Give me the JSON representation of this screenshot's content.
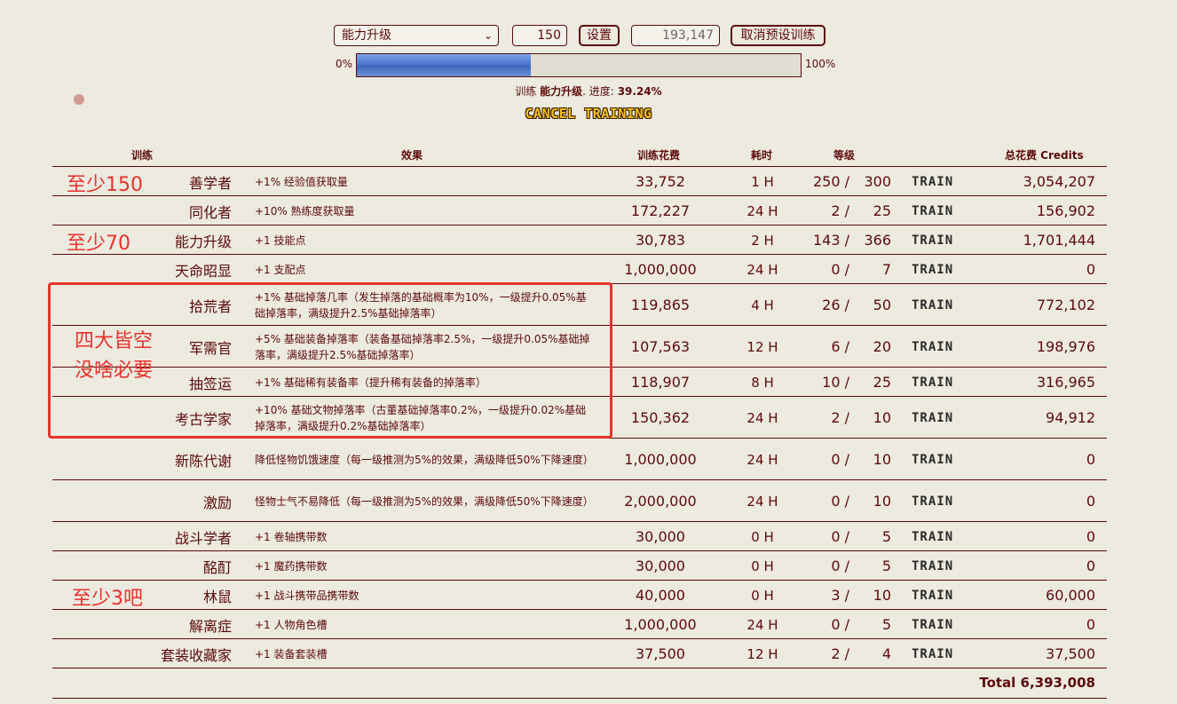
{
  "controls": {
    "select_value": "能力升级",
    "quantity_value": "150",
    "set_label": "设置",
    "credits_value": "193,147",
    "cancel_preset_label": "取消预设训练"
  },
  "progress": {
    "min_label": "0%",
    "max_label": "100%",
    "fraction": 0.3924,
    "status_prefix": "训练",
    "status_skill": "能力升级",
    "status_mid": ". 进度:",
    "status_pct": "39.24%",
    "cancel_label": "CANCEL TRAINING"
  },
  "table": {
    "headers": {
      "train": "训练",
      "effect": "效果",
      "cost": "训练花费",
      "time": "耗时",
      "level": "等级",
      "total": "总花费 Credits"
    },
    "rows": [
      {
        "name": "善学者",
        "effect": "+1% 经验值获取量",
        "cost": "33,752",
        "time": "1 H",
        "level": "250 /",
        "max": "300",
        "train": "TRAIN",
        "total": "3,054,207"
      },
      {
        "name": "同化者",
        "effect": "+10% 熟练度获取量",
        "cost": "172,227",
        "time": "24 H",
        "level": "2 /",
        "max": "25",
        "train": "TRAIN",
        "total": "156,902"
      },
      {
        "name": "能力升级",
        "effect": "+1 技能点",
        "cost": "30,783",
        "time": "2 H",
        "level": "143 /",
        "max": "366",
        "train": "TRAIN",
        "total": "1,701,444"
      },
      {
        "name": "天命昭显",
        "effect": "+1 支配点",
        "cost": "1,000,000",
        "time": "24 H",
        "level": "0 /",
        "max": "7",
        "train": "TRAIN",
        "total": "0"
      },
      {
        "name": "拾荒者",
        "effect": "+1% 基础掉落几率（发生掉落的基础概率为10%，一级提升0.05%基础掉落率，满级提升2.5%基础掉落率）",
        "cost": "119,865",
        "time": "4 H",
        "level": "26 /",
        "max": "50",
        "train": "TRAIN",
        "total": "772,102"
      },
      {
        "name": "军需官",
        "effect": "+5% 基础装备掉落率（装备基础掉落率2.5%，一级提升0.05%基础掉落率，满级提升2.5%基础掉落率）",
        "cost": "107,563",
        "time": "12 H",
        "level": "6 /",
        "max": "20",
        "train": "TRAIN",
        "total": "198,976"
      },
      {
        "name": "抽签运",
        "effect": "+1% 基础稀有装备率（提升稀有装备的掉落率）",
        "cost": "118,907",
        "time": "8 H",
        "level": "10 /",
        "max": "25",
        "train": "TRAIN",
        "total": "316,965"
      },
      {
        "name": "考古学家",
        "effect": "+10% 基础文物掉落率（古董基础掉落率0.2%，一级提升0.02%基础掉落率，满级提升0.2%基础掉落率）",
        "cost": "150,362",
        "time": "24 H",
        "level": "2 /",
        "max": "10",
        "train": "TRAIN",
        "total": "94,912"
      },
      {
        "name": "新陈代谢",
        "effect": "降低怪物饥饿速度（每一级推测为5%的效果，满级降低50%下降速度）",
        "cost": "1,000,000",
        "time": "24 H",
        "level": "0 /",
        "max": "10",
        "train": "TRAIN",
        "total": "0"
      },
      {
        "name": "激励",
        "effect": "怪物士气不易降低（每一级推测为5%的效果，满级降低50%下降速度）",
        "cost": "2,000,000",
        "time": "24 H",
        "level": "0 /",
        "max": "10",
        "train": "TRAIN",
        "total": "0"
      },
      {
        "name": "战斗学者",
        "effect": "+1 卷轴携带数",
        "cost": "30,000",
        "time": "0 H",
        "level": "0 /",
        "max": "5",
        "train": "TRAIN",
        "total": "0"
      },
      {
        "name": "酩酊",
        "effect": "+1 魔药携带数",
        "cost": "30,000",
        "time": "0 H",
        "level": "0 /",
        "max": "5",
        "train": "TRAIN",
        "total": "0"
      },
      {
        "name": "林鼠",
        "effect": "+1 战斗携带品携带数",
        "cost": "40,000",
        "time": "0 H",
        "level": "3 /",
        "max": "10",
        "train": "TRAIN",
        "total": "60,000"
      },
      {
        "name": "解离症",
        "effect": "+1 人物角色槽",
        "cost": "1,000,000",
        "time": "24 H",
        "level": "0 /",
        "max": "5",
        "train": "TRAIN",
        "total": "0"
      },
      {
        "name": "套装收藏家",
        "effect": "+1 装备套装槽",
        "cost": "37,500",
        "time": "12 H",
        "level": "2 /",
        "max": "4",
        "train": "TRAIN",
        "total": "37,500"
      }
    ],
    "grand_total": "Total 6,393,008"
  },
  "annotations": {
    "a1": "至少150",
    "a2": "至少70",
    "a3_line1": "四大皆空",
    "a3_line2": "没啥必要",
    "a4": "至少3吧",
    "color": "#E8332C"
  }
}
